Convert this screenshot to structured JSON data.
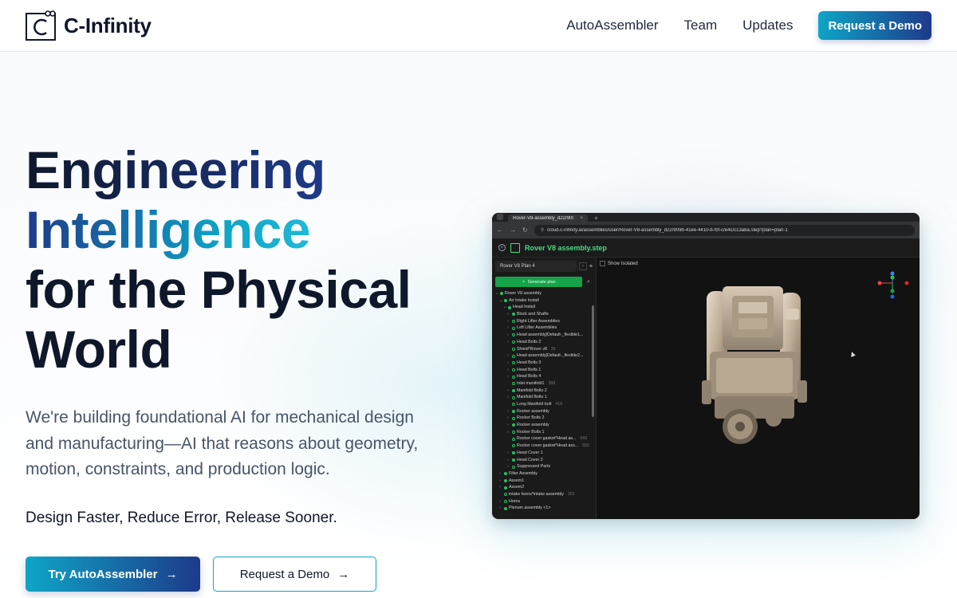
{
  "nav": {
    "brand": "C-Infinity",
    "links": [
      "AutoAssembler",
      "Team",
      "Updates"
    ],
    "cta": "Request a Demo"
  },
  "hero": {
    "headline": [
      "Engineering",
      "Intelligence",
      "for the Physical",
      "World"
    ],
    "lead": "We're building foundational AI for mechanical design and manufacturing—AI that reasons about geometry, motion, constraints, and production logic.",
    "tagline": "Design Faster, Reduce Error, Release Sooner.",
    "primary_button": "Try AutoAssembler",
    "secondary_button": "Request a Demo"
  },
  "app_shot": {
    "tab_title": "Rover-V8-assembly_d22/909b-",
    "url": "cloud.c-infinity.ai/assemblies/user/Rover-V8-assembly_d22/909b-41ee-4410-b7bf-c/e4c/c13aba.step?plan=plan-1",
    "file_name": "Rover V8 assembly.step",
    "plan_select": "Rover V8 Plan 4",
    "generate_label": "Generate plan",
    "show_isolated": "Show Isolated",
    "tree": [
      {
        "indent": 0,
        "chev": "v",
        "icon": "g",
        "label": "Rover V8 assembly"
      },
      {
        "indent": 1,
        "chev": "v",
        "icon": "g",
        "label": "Air Intake Install"
      },
      {
        "indent": 2,
        "chev": "v",
        "icon": "g",
        "label": "Head Install"
      },
      {
        "indent": 3,
        "chev": ">",
        "icon": "g",
        "label": "Block and Shafts"
      },
      {
        "indent": 3,
        "chev": ">",
        "icon": "o",
        "label": "Right Lifter Assemblies"
      },
      {
        "indent": 3,
        "chev": ">",
        "icon": "o",
        "label": "Left Lifter Assemblies"
      },
      {
        "indent": 3,
        "chev": ">",
        "icon": "o",
        "label": "Head assembly[Default-_flexible1..."
      },
      {
        "indent": 3,
        "chev": ">",
        "icon": "o",
        "label": "Head Bolts 2"
      },
      {
        "indent": 3,
        "chev": "",
        "icon": "o",
        "label": "Shield*Rover v8",
        "count": "31"
      },
      {
        "indent": 3,
        "chev": ">",
        "icon": "o",
        "label": "Head assembly[Default-_flexible2..."
      },
      {
        "indent": 3,
        "chev": ">",
        "icon": "o",
        "label": "Head Bolts 3"
      },
      {
        "indent": 3,
        "chev": ">",
        "icon": "o",
        "label": "Head Bolts 1"
      },
      {
        "indent": 3,
        "chev": ">",
        "icon": "o",
        "label": "Head Bolts 4"
      },
      {
        "indent": 3,
        "chev": "",
        "icon": "o",
        "label": "Inlet manifold1",
        "count": "399"
      },
      {
        "indent": 3,
        "chev": ">",
        "icon": "g",
        "label": "Manifold Bolts 2"
      },
      {
        "indent": 3,
        "chev": ">",
        "icon": "o",
        "label": "Manifold Bolts 1"
      },
      {
        "indent": 3,
        "chev": "",
        "icon": "o",
        "label": "Long Manifold bolt",
        "count": "416"
      },
      {
        "indent": 3,
        "chev": ">",
        "icon": "g",
        "label": "Rocker assembly"
      },
      {
        "indent": 3,
        "chev": ">",
        "icon": "o",
        "label": "Rocker Bolts 2"
      },
      {
        "indent": 3,
        "chev": ">",
        "icon": "g",
        "label": "Rocker assembly"
      },
      {
        "indent": 3,
        "chev": ">",
        "icon": "o",
        "label": "Rocker Bolts 1"
      },
      {
        "indent": 3,
        "chev": "",
        "icon": "o",
        "label": "Rocker cover gasket*Head as...",
        "count": "642"
      },
      {
        "indent": 3,
        "chev": "",
        "icon": "o",
        "label": "Rocker cover gasket*Head ass...",
        "count": "552"
      },
      {
        "indent": 3,
        "chev": ">",
        "icon": "g",
        "label": "Head Cover 1"
      },
      {
        "indent": 3,
        "chev": ">",
        "icon": "g",
        "label": "Head Cover 2"
      },
      {
        "indent": 3,
        "chev": ">",
        "icon": "o",
        "label": "Suppressed Parts"
      },
      {
        "indent": 1,
        "chev": ">",
        "icon": "g",
        "label": "Filter Assembly"
      },
      {
        "indent": 1,
        "chev": ">",
        "icon": "g",
        "label": "Assem1"
      },
      {
        "indent": 1,
        "chev": ">",
        "icon": "g",
        "label": "Assem2"
      },
      {
        "indent": 1,
        "chev": "",
        "icon": "o",
        "label": "intake horns*intake assembly",
        "count": "361"
      },
      {
        "indent": 1,
        "chev": ">",
        "icon": "o",
        "label": "Horns"
      },
      {
        "indent": 1,
        "chev": ">",
        "icon": "g",
        "label": "Plenum assembly <1>"
      }
    ],
    "colors": {
      "accent": "#22c55e",
      "brand_cyan": "#0ea5c6",
      "brand_navy": "#1e3a8a"
    }
  }
}
